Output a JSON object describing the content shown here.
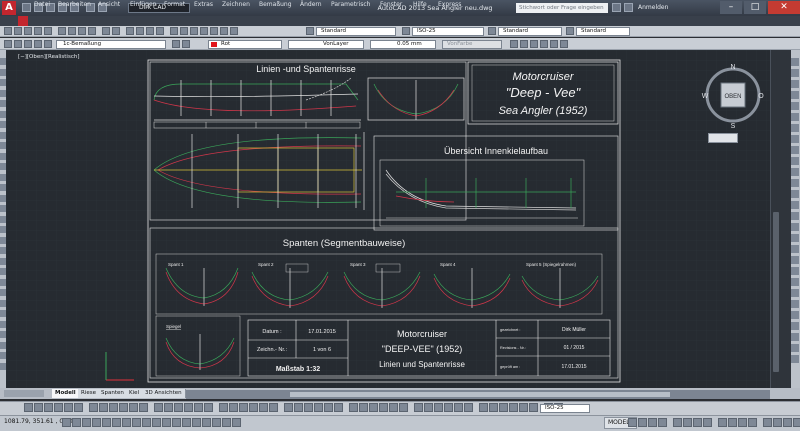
{
  "window": {
    "title": "AutoCAD 2013    Sea Angler neu.dwg",
    "workspace": "Dirk CAD",
    "search_placeholder": "Stichwort oder Frage eingeben",
    "login": "Anmelden"
  },
  "menu": [
    "Datei",
    "Bearbeiten",
    "Ansicht",
    "Einfügen",
    "Format",
    "Extras",
    "Zeichnen",
    "Bemaßung",
    "Ändern",
    "Parametrisch",
    "Fenster",
    "Hilfe",
    "Express"
  ],
  "toolbar": {
    "row1_combos": [
      "Standard",
      "ISO-25",
      "Standard",
      "Standard"
    ],
    "layer": "1c-Bemaßung",
    "color": "Rot",
    "linetype": "VonLayer",
    "lineweight": "0.05 mm",
    "plotstyle": "VonFarbe"
  },
  "viewport_label": "[−][Oben][Realistisch]",
  "navcube": {
    "face": "OBEN",
    "n": "N",
    "s": "S",
    "w": "W",
    "o": "O"
  },
  "drawing": {
    "section_lines": "Linien -und Spantenrisse",
    "section_keel": "Übersicht Innenkielaufbau",
    "section_frames": "Spanten (Segmentbauweise)",
    "frames": [
      "Spant 1",
      "Spant 2",
      "Spant 3",
      "Spant 4",
      "Spant 5 (Spiegelrahmen)"
    ],
    "transom": "Spiegel",
    "title_block": {
      "line1": "Motorcruiser",
      "line2": "\"Deep - Vee\"",
      "line3": "Sea Angler (1952)"
    },
    "info": {
      "datum_label": "Datum :",
      "datum_value": "17.01.2015",
      "zeichn_label": "Zeichn.- Nr.:",
      "zeichn_value": "1 von 6",
      "massstab": "Maßstab 1:32",
      "center1": "Motorcruiser",
      "center2": "\"DEEP-VEE\" (1952)",
      "center3": "Linien und Spantenrisse",
      "konstruiert_label": "gezeichnet :",
      "konstruiert_value": "Dirk Müller",
      "revision_label": "Revisions - Nr.:",
      "revision_value": "01 / 2015",
      "geprueft_label": "geprüft am :",
      "geprueft_value": "17.01.2015"
    }
  },
  "tabs": [
    "Modell",
    "Riese",
    "Spanten",
    "Kiel",
    "3D Ansichten"
  ],
  "status": {
    "coords": "1081.79, 351.61 , 0.00",
    "model": "MODELL",
    "scale": "ISO-25"
  }
}
